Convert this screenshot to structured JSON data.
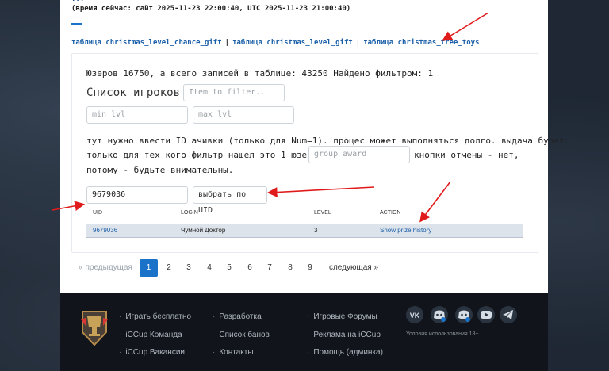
{
  "header": {
    "top_line": "...",
    "time_line": "(время сейчас: сайт 2025-11-23 22:00:40, UTC 2025-11-23 21:00:40)"
  },
  "table_links": [
    "таблица christmas_level_chance_gift",
    "таблица christmas_level_gift",
    "таблица christmas_tree_toys"
  ],
  "links_sep": "|",
  "summary": "Юзеров 16750, а всего записей в таблице: 43250 Найдено фильтром: 1",
  "players_title": "Список игроков",
  "filter_placeholder": "Item to filter..",
  "min_lvl_placeholder": "min lvl",
  "max_lvl_placeholder": "max lvl",
  "award_text_1": "тут нужно ввести ID ачивки (только для Num=1). процес может выполняться долго. выдача будет",
  "award_text_2a": "только для тех кого фильтр нашел это 1 юзеров.",
  "award_text_2b": "кнопки отмены - нет,",
  "award_text_3": "потому - будьте внимательны.",
  "group_award_placeholder": "group award",
  "uid_value": "9679036",
  "select_uid_label": "выбрать по UID",
  "table": {
    "columns": [
      "UID",
      "LOGIN",
      "LEVEL",
      "ACTION"
    ],
    "rows": [
      {
        "uid": "9679036",
        "login": "Чумной Доктор",
        "level": "3",
        "action": "Show prize history"
      }
    ]
  },
  "pagination": {
    "prev": "« предыдущая",
    "pages": [
      "1",
      "2",
      "3",
      "4",
      "5",
      "6",
      "7",
      "8",
      "9"
    ],
    "current": "1",
    "next": "следующая »"
  },
  "footer": {
    "col1": [
      "Играть бесплатно",
      "iCCup Команда",
      "iCCup Вакансии"
    ],
    "col2": [
      "Разработка",
      "Список банов",
      "Контакты"
    ],
    "col3": [
      "Игровые Форумы",
      "Реклама на iCCup",
      "Помощь (админка)"
    ],
    "social_icons": [
      "vk-icon",
      "discord-icon",
      "discord-settings-icon",
      "youtube-icon",
      "telegram-icon"
    ],
    "terms": "Условия использования 18+"
  },
  "colors": {
    "accent": "#1a73c8",
    "annotation_arrow": "#e01b1b",
    "footer_bg": "#11151b"
  }
}
